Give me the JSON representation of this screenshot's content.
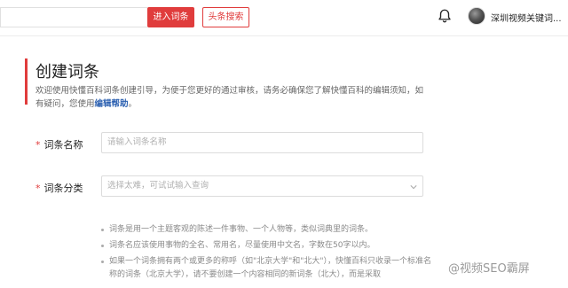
{
  "header": {
    "enter_button": "进入词条",
    "toutiao_button": "头条搜索",
    "username": "深圳视频关键词..."
  },
  "page": {
    "title": "创建词条",
    "intro_text": "欢迎使用快懂百科词条创建引导，为便于您更好的通过审核，请务必确保您了解快懂百科的编辑须知，如有疑问，您使用",
    "intro_link": "编辑帮助",
    "intro_end": "。"
  },
  "form": {
    "required_mark": "*",
    "name_label": "词条名称",
    "name_placeholder": "请输入词条名称",
    "category_label": "词条分类",
    "category_placeholder": "选择太难，可试试输入查询"
  },
  "tips": [
    "词条是用一个主题客观的陈述一件事物、一个人物等，类似词典里的词条。",
    "词条名应该使用事物的全名、常用名，尽量使用中文名，字数在50字以内。",
    "如果一个词条拥有两个或更多的称呼（如\"北京大学\"和\"北大\"），快懂百科只收录一个标准名称的词条（北京大学），请不要创建一个内容相同的新词条（北大），而是采取"
  ],
  "watermark": "@视频SEO霸屏",
  "colors": {
    "accent": "#e03c3c",
    "link": "#2a5fb0"
  },
  "icons": {
    "bell": "bell-icon",
    "dropdown": "chevron-down-icon"
  }
}
